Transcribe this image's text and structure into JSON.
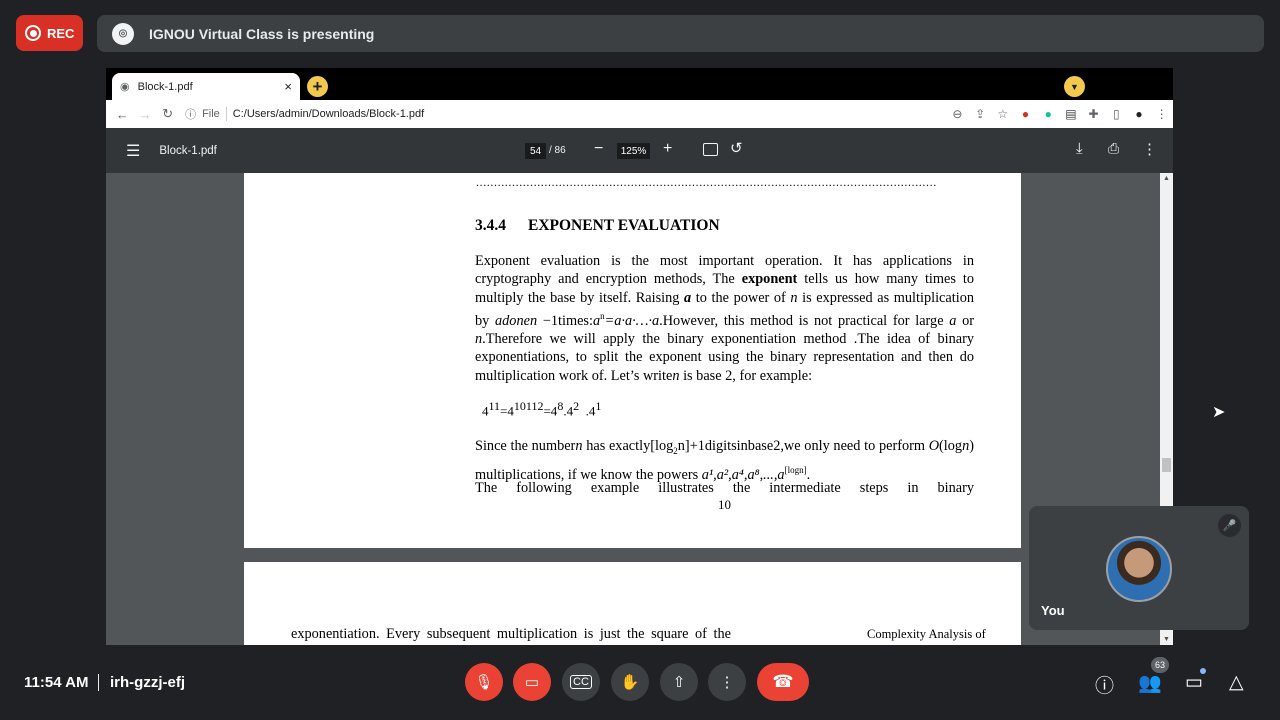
{
  "top": {
    "rec_label": "REC",
    "presenting_text": "IGNOU Virtual Class is presenting"
  },
  "browser": {
    "tab_title": "Block-1.pdf",
    "tab_close": "×",
    "new_tab": "+",
    "url_scheme": "File",
    "url": "C:/Users/admin/Downloads/Block-1.pdf"
  },
  "pdf_toolbar": {
    "doc_name": "Block-1.pdf",
    "current_page": "54",
    "total_pages": "/  86",
    "zoom": "125%"
  },
  "page1": {
    "dots": "................................................................................................................................",
    "section_number": "3.4.4",
    "section_title": "EXPONENT EVALUATION",
    "para1_a": "Exponent evaluation is the most important operation. It has applications in cryptography and encryption methods, The ",
    "para1_bold": "exponent",
    "para1_b": " tells us how many times to multiply the base by itself. Raising ",
    "para1_c": "a",
    "para1_d": " to the power of ",
    "para1_e": "n",
    "para1_f": " is expressed as multiplication by ",
    "para1_g": "adonen",
    "para1_h": " −1times:",
    "para1_i": "a",
    "para1_j": "n",
    "para1_k": "=a·a·…·a",
    "para1_l": ".However, this method is not practical for large ",
    "para1_m": "a",
    "para1_n": " or ",
    "para1_o": "n",
    "para1_p": ".Therefore we will apply the binary exponentiation method .The idea of binary exponentiations, to split the exponent using the binary representation and then do multiplication work of. Let’s write",
    "para1_q": "n",
    "para1_r": " is base 2, for example:",
    "formula_base1": "4",
    "formula_exp1": "11",
    "formula_eq1": "=4",
    "formula_exp2": "10112",
    "formula_eq2": "=4",
    "formula_exp3": "8",
    "formula_dot": ".4",
    "formula_exp4": "2",
    "formula_end": "  .4",
    "formula_exp5": "1",
    "para2_a": "Since the number",
    "para2_b": "n",
    "para2_c": " has exactly[log",
    "para2_sub": "2",
    "para2_d": "n]+1digitsinbase2,we only need to perform ",
    "para2_e": "O",
    "para2_f": "(log",
    "para2_g": "n",
    "para2_h": ") multiplications, if we know the powers ",
    "para2_powers": "a¹,a²,a⁴,a⁸,...,a",
    "para2_sup": "[logn]",
    "para2_end": ".",
    "para3": "The following example illustrates the intermediate steps in binary",
    "page_number": "10"
  },
  "page2": {
    "text": "exponentiation. Every subsequent multiplication is just the square of the",
    "side_text": "Complexity Analysis of"
  },
  "self_tile": {
    "name": "You"
  },
  "bottom": {
    "time": "11:54 AM",
    "meeting_code": "irh-gzzj-efj",
    "participants_count": "63"
  },
  "colors": {
    "accent_red": "#ea4335",
    "tab_yellow": "#f2c94c",
    "meet_bg": "#202124"
  }
}
